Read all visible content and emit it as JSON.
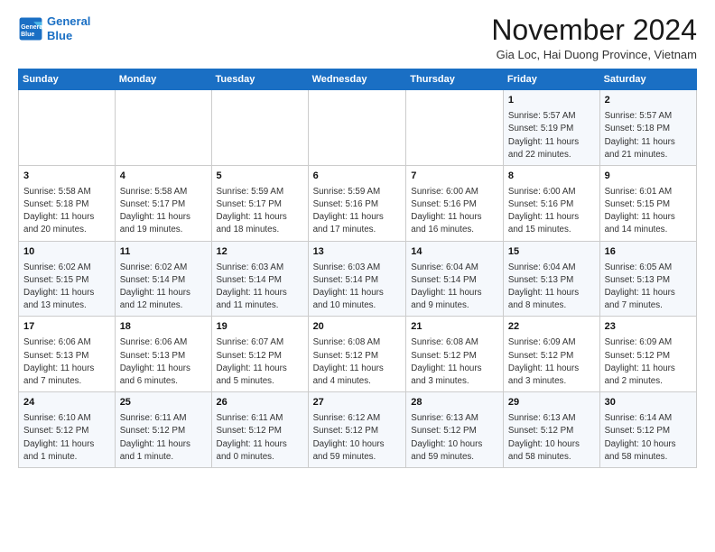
{
  "header": {
    "logo_line1": "General",
    "logo_line2": "Blue",
    "month_title": "November 2024",
    "location": "Gia Loc, Hai Duong Province, Vietnam"
  },
  "weekdays": [
    "Sunday",
    "Monday",
    "Tuesday",
    "Wednesday",
    "Thursday",
    "Friday",
    "Saturday"
  ],
  "weeks": [
    [
      {
        "day": "",
        "info": ""
      },
      {
        "day": "",
        "info": ""
      },
      {
        "day": "",
        "info": ""
      },
      {
        "day": "",
        "info": ""
      },
      {
        "day": "",
        "info": ""
      },
      {
        "day": "1",
        "info": "Sunrise: 5:57 AM\nSunset: 5:19 PM\nDaylight: 11 hours\nand 22 minutes."
      },
      {
        "day": "2",
        "info": "Sunrise: 5:57 AM\nSunset: 5:18 PM\nDaylight: 11 hours\nand 21 minutes."
      }
    ],
    [
      {
        "day": "3",
        "info": "Sunrise: 5:58 AM\nSunset: 5:18 PM\nDaylight: 11 hours\nand 20 minutes."
      },
      {
        "day": "4",
        "info": "Sunrise: 5:58 AM\nSunset: 5:17 PM\nDaylight: 11 hours\nand 19 minutes."
      },
      {
        "day": "5",
        "info": "Sunrise: 5:59 AM\nSunset: 5:17 PM\nDaylight: 11 hours\nand 18 minutes."
      },
      {
        "day": "6",
        "info": "Sunrise: 5:59 AM\nSunset: 5:16 PM\nDaylight: 11 hours\nand 17 minutes."
      },
      {
        "day": "7",
        "info": "Sunrise: 6:00 AM\nSunset: 5:16 PM\nDaylight: 11 hours\nand 16 minutes."
      },
      {
        "day": "8",
        "info": "Sunrise: 6:00 AM\nSunset: 5:16 PM\nDaylight: 11 hours\nand 15 minutes."
      },
      {
        "day": "9",
        "info": "Sunrise: 6:01 AM\nSunset: 5:15 PM\nDaylight: 11 hours\nand 14 minutes."
      }
    ],
    [
      {
        "day": "10",
        "info": "Sunrise: 6:02 AM\nSunset: 5:15 PM\nDaylight: 11 hours\nand 13 minutes."
      },
      {
        "day": "11",
        "info": "Sunrise: 6:02 AM\nSunset: 5:14 PM\nDaylight: 11 hours\nand 12 minutes."
      },
      {
        "day": "12",
        "info": "Sunrise: 6:03 AM\nSunset: 5:14 PM\nDaylight: 11 hours\nand 11 minutes."
      },
      {
        "day": "13",
        "info": "Sunrise: 6:03 AM\nSunset: 5:14 PM\nDaylight: 11 hours\nand 10 minutes."
      },
      {
        "day": "14",
        "info": "Sunrise: 6:04 AM\nSunset: 5:14 PM\nDaylight: 11 hours\nand 9 minutes."
      },
      {
        "day": "15",
        "info": "Sunrise: 6:04 AM\nSunset: 5:13 PM\nDaylight: 11 hours\nand 8 minutes."
      },
      {
        "day": "16",
        "info": "Sunrise: 6:05 AM\nSunset: 5:13 PM\nDaylight: 11 hours\nand 7 minutes."
      }
    ],
    [
      {
        "day": "17",
        "info": "Sunrise: 6:06 AM\nSunset: 5:13 PM\nDaylight: 11 hours\nand 7 minutes."
      },
      {
        "day": "18",
        "info": "Sunrise: 6:06 AM\nSunset: 5:13 PM\nDaylight: 11 hours\nand 6 minutes."
      },
      {
        "day": "19",
        "info": "Sunrise: 6:07 AM\nSunset: 5:12 PM\nDaylight: 11 hours\nand 5 minutes."
      },
      {
        "day": "20",
        "info": "Sunrise: 6:08 AM\nSunset: 5:12 PM\nDaylight: 11 hours\nand 4 minutes."
      },
      {
        "day": "21",
        "info": "Sunrise: 6:08 AM\nSunset: 5:12 PM\nDaylight: 11 hours\nand 3 minutes."
      },
      {
        "day": "22",
        "info": "Sunrise: 6:09 AM\nSunset: 5:12 PM\nDaylight: 11 hours\nand 3 minutes."
      },
      {
        "day": "23",
        "info": "Sunrise: 6:09 AM\nSunset: 5:12 PM\nDaylight: 11 hours\nand 2 minutes."
      }
    ],
    [
      {
        "day": "24",
        "info": "Sunrise: 6:10 AM\nSunset: 5:12 PM\nDaylight: 11 hours\nand 1 minute."
      },
      {
        "day": "25",
        "info": "Sunrise: 6:11 AM\nSunset: 5:12 PM\nDaylight: 11 hours\nand 1 minute."
      },
      {
        "day": "26",
        "info": "Sunrise: 6:11 AM\nSunset: 5:12 PM\nDaylight: 11 hours\nand 0 minutes."
      },
      {
        "day": "27",
        "info": "Sunrise: 6:12 AM\nSunset: 5:12 PM\nDaylight: 10 hours\nand 59 minutes."
      },
      {
        "day": "28",
        "info": "Sunrise: 6:13 AM\nSunset: 5:12 PM\nDaylight: 10 hours\nand 59 minutes."
      },
      {
        "day": "29",
        "info": "Sunrise: 6:13 AM\nSunset: 5:12 PM\nDaylight: 10 hours\nand 58 minutes."
      },
      {
        "day": "30",
        "info": "Sunrise: 6:14 AM\nSunset: 5:12 PM\nDaylight: 10 hours\nand 58 minutes."
      }
    ]
  ]
}
